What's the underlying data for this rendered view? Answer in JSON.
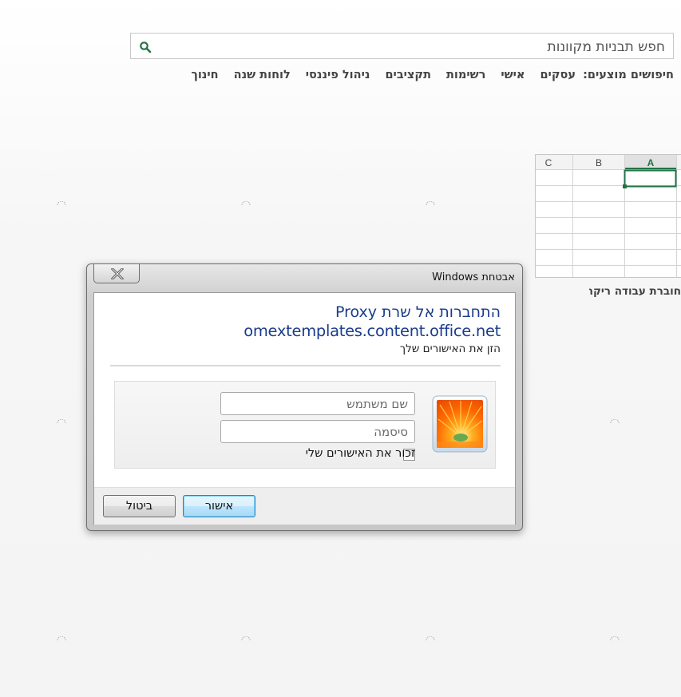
{
  "search": {
    "placeholder": "חפש תבניות מקוונות"
  },
  "suggested": {
    "label": "חיפושים מוצעים:",
    "items": [
      "עסקים",
      "אישי",
      "רשימות",
      "תקציבים",
      "ניהול פיננסי",
      "לוחות שנה",
      "חינוך"
    ]
  },
  "template_thumb": {
    "columns": [
      "A",
      "B",
      "C"
    ],
    "label": "חוברת עבודה ריקה",
    "accent_color": "#217346"
  },
  "dialog": {
    "title": "אבטחת Windows",
    "heading_line1": "התחברות אל שרת Proxy",
    "heading_line2": "omextemplates.content.office.net",
    "instruction": "הזן את האישורים שלך",
    "username_placeholder": "שם משתמש",
    "password_placeholder": "סיסמה",
    "remember_label": "זכור את האישורים שלי",
    "ok_label": "אישור",
    "cancel_label": "ביטול",
    "heading_color": "#1a3c8c"
  }
}
